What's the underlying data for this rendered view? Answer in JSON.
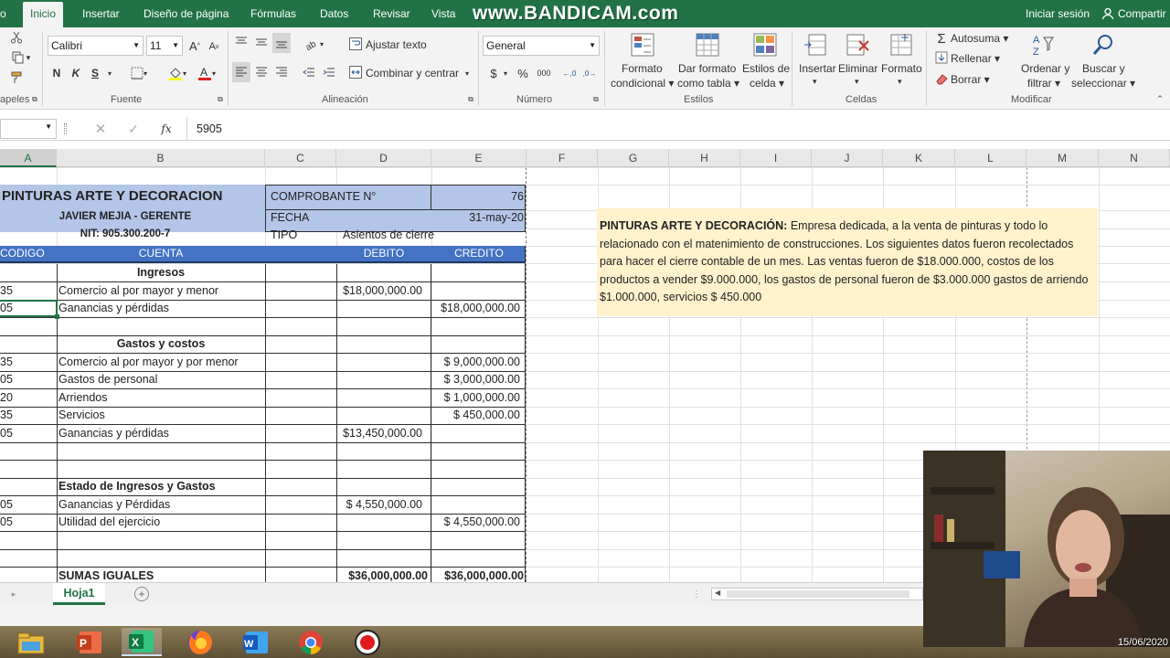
{
  "ribbon_tabs": {
    "archivo": "o",
    "inicio": "Inicio",
    "insertar": "Insertar",
    "diseno": "Diseño de página",
    "formulas": "Fórmulas",
    "datos": "Datos",
    "revisar": "Revisar",
    "vista": "Vista",
    "watermark": "www.BANDICAM.com",
    "signin": "Iniciar sesión",
    "share": "Compartir"
  },
  "ribbon": {
    "font_name": "Calibri",
    "font_size": "11",
    "bold": "N",
    "italic": "K",
    "underline": "S",
    "wrap_text": "Ajustar texto",
    "merge_center": "Combinar y centrar",
    "number_format": "General",
    "currency": "$",
    "percent": "%",
    "thousands": "000",
    "cond_format_1": "Formato",
    "cond_format_2": "condicional",
    "table_format_1": "Dar formato",
    "table_format_2": "como tabla",
    "cell_styles_1": "Estilos de",
    "cell_styles_2": "celda",
    "insert": "Insertar",
    "delete": "Eliminar",
    "format": "Formato",
    "autosum": "Autosuma",
    "fill": "Rellenar",
    "clear": "Borrar",
    "sort_1": "Ordenar y",
    "sort_2": "filtrar",
    "find_1": "Buscar y",
    "find_2": "seleccionar",
    "groups": {
      "clipboard": "pelesPapeles",
      "clip_short": "apeles",
      "font": "Fuente",
      "alignment": "Alineación",
      "number": "Número",
      "styles": "Estilos",
      "cells": "Celdas",
      "edit": "Modificar"
    }
  },
  "formula_bar": {
    "fx": "fx",
    "value": "5905"
  },
  "columns": [
    "A",
    "B",
    "C",
    "D",
    "E",
    "F",
    "G",
    "H",
    "I",
    "J",
    "K",
    "L",
    "M",
    "N"
  ],
  "sheet": {
    "company": "PINTURAS ARTE Y DECORACION",
    "manager": "JAVIER MEJÍA - GERENTE",
    "nit": "NIT: 905.300.200-7",
    "voucher_label": "COMPROBANTE N°",
    "voucher_value": "76",
    "date_label": "FECHA",
    "date_value": "31-may-20",
    "type_label": "TIPO",
    "type_value": "Asientos de cierre",
    "hdr_code": "CODIGO",
    "hdr_account": "CUENTA",
    "hdr_debit": "DEBITO",
    "hdr_credit": "CREDITO",
    "rows": [
      {
        "code": "",
        "account": "Ingresos",
        "debit": "",
        "credit": "",
        "section": true
      },
      {
        "code": "35",
        "account": "Comercio al por mayor y menor",
        "debit": "$18,000,000.00",
        "credit": ""
      },
      {
        "code": "05",
        "account": "Ganancias y pérdidas",
        "debit": "",
        "credit": "$18,000,000.00"
      },
      {
        "code": "",
        "account": "",
        "debit": "",
        "credit": ""
      },
      {
        "code": "",
        "account": "Gastos y costos",
        "debit": "",
        "credit": "",
        "section": true
      },
      {
        "code": "35",
        "account": "Comercio al por mayor y por menor",
        "debit": "",
        "credit": "$  9,000,000.00"
      },
      {
        "code": "05",
        "account": "Gastos de personal",
        "debit": "",
        "credit": "$  3,000,000.00"
      },
      {
        "code": "20",
        "account": "Arriendos",
        "debit": "",
        "credit": "$  1,000,000.00"
      },
      {
        "code": "35",
        "account": "Servicios",
        "debit": "",
        "credit": "$      450,000.00"
      },
      {
        "code": "05",
        "account": "Ganancias y pérdidas",
        "debit": "$13,450,000.00",
        "credit": ""
      },
      {
        "code": "",
        "account": "",
        "debit": "",
        "credit": ""
      },
      {
        "code": "",
        "account": "",
        "debit": "",
        "credit": ""
      },
      {
        "code": "",
        "account": "Estado de Ingresos y Gastos",
        "debit": "",
        "credit": "",
        "bold": true
      },
      {
        "code": "05",
        "account": "Ganancias y Pérdidas",
        "debit": "$  4,550,000.00",
        "credit": ""
      },
      {
        "code": "05",
        "account": "Utilidad del ejercicio",
        "debit": "",
        "credit": "$  4,550,000.00"
      },
      {
        "code": "",
        "account": "",
        "debit": "",
        "credit": ""
      },
      {
        "code": "",
        "account": "",
        "debit": "",
        "credit": ""
      },
      {
        "code": "",
        "account": "SUMAS IGUALES",
        "debit": "$36,000,000.00",
        "credit": "$36,000,000.00",
        "bold": true
      }
    ],
    "note_title": "PINTURAS ARTE Y DECORACIÓN:",
    "note_body": " Empresa dedicada, a la venta de pinturas y todo lo relacionado con el matenimiento de construcciones. Los siguientes datos fueron recolectados para hacer el cierre contable de un mes. Las ventas  fueron de $18.000.000, costos de los productos a vender $9.000.000, los gastos de personal fueron de $3.000.000 gastos de arriendo $1.000.000, servicios $ 450.000"
  },
  "sheet_tab": "Hoja1",
  "webcam_date": "15/06/2020",
  "colors": {
    "excel_green": "#217346",
    "header_blue": "#4472c4",
    "light_blue": "#b4c6e7",
    "note_bg": "#fff2cc"
  }
}
